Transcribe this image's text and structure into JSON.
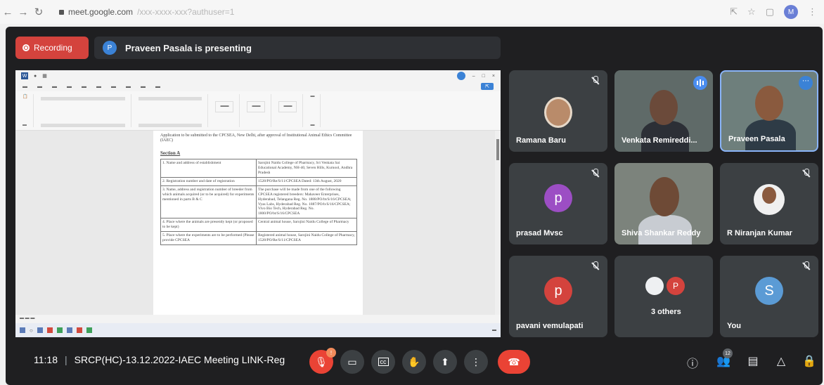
{
  "browser": {
    "url_host": "meet.google.com",
    "url_path": "/xxx-xxxx-xxx?authuser=1",
    "profile_initial": "M"
  },
  "recording": {
    "label": "Recording"
  },
  "presenting": {
    "avatar_initial": "P",
    "text": "Praveen Pasala is presenting"
  },
  "shared_doc": {
    "intro": "Application to be submitted to the CPCSEA, New Delhi, after approval of Institutional Animal Ethics Committee (IAEC)",
    "section": "Section A",
    "rows": [
      {
        "label": "1.  Name and address of establishment",
        "value": "Sarojini Naidu College of Pharmacy, Sri Venkata Sai Educational Academy, NH-40, Seven Hills, Kurnool, Andhra Pradesh"
      },
      {
        "label": "2.  Registration number and date of registration",
        "value": "1528/PO/Re/S/11/CPCSEA Dated: 13th August, 2020"
      },
      {
        "label": "3.  Name, address and registration number of breeder from which animals acquired (or to be acquired) for experiments mentioned in parts B & C",
        "value": "The purchase will be made from one of the following CPCSEA registered breeders: Mahaveer Enterprises, Hyderabad, Telangana Reg. No. 1888/PO/bt/S/16/CPCSEA; Vyas Labs, Hyderabad Reg. No. 1887/PO/b/S/16/CPCSEA; Vivo Bio Tech, Hyderabad Reg. No. 1800/PO/bt/S/16/CPCSEA"
      },
      {
        "label": "4.  Place where the animals are presently kept (or proposed to be kept)",
        "value": "Central animal house, Sarojini Naidu College of Pharmacy"
      },
      {
        "label": "5.  Place where the experiments are to be performed (Please provide CPCSEA",
        "value": "Registered animal house, Sarojini Naidu College of Pharmacy, 1528/PO/Re/S/11/CPCSEA"
      }
    ]
  },
  "participants": [
    {
      "name": "Ramana Baru",
      "muted": true,
      "video": true
    },
    {
      "name": "Venkata Remireddi...",
      "muted": false,
      "video": true,
      "speaking": true
    },
    {
      "name": "Praveen Pasala",
      "muted": false,
      "video": true,
      "active": true
    },
    {
      "name": "prasad Mvsc",
      "muted": true,
      "initial": "p",
      "color": "#9c4ec4"
    },
    {
      "name": "Shiva Shankar Reddy",
      "muted": false,
      "video": true
    },
    {
      "name": "R Niranjan Kumar",
      "muted": true,
      "video": true
    },
    {
      "name": "pavani vemulapati",
      "muted": true,
      "initial": "p",
      "color": "#d4433d"
    },
    {
      "name": "3 others",
      "initial": "P",
      "color": "#d4433d"
    },
    {
      "name": "You",
      "muted": true,
      "initial": "S",
      "color": "#5b9bd5"
    }
  ],
  "controls": {
    "time": "11:18",
    "meeting_name": "SRCP(HC)-13.12.2022-IAEC Meeting LINK-Reg",
    "mic_badge": "!",
    "participant_count": "12"
  }
}
